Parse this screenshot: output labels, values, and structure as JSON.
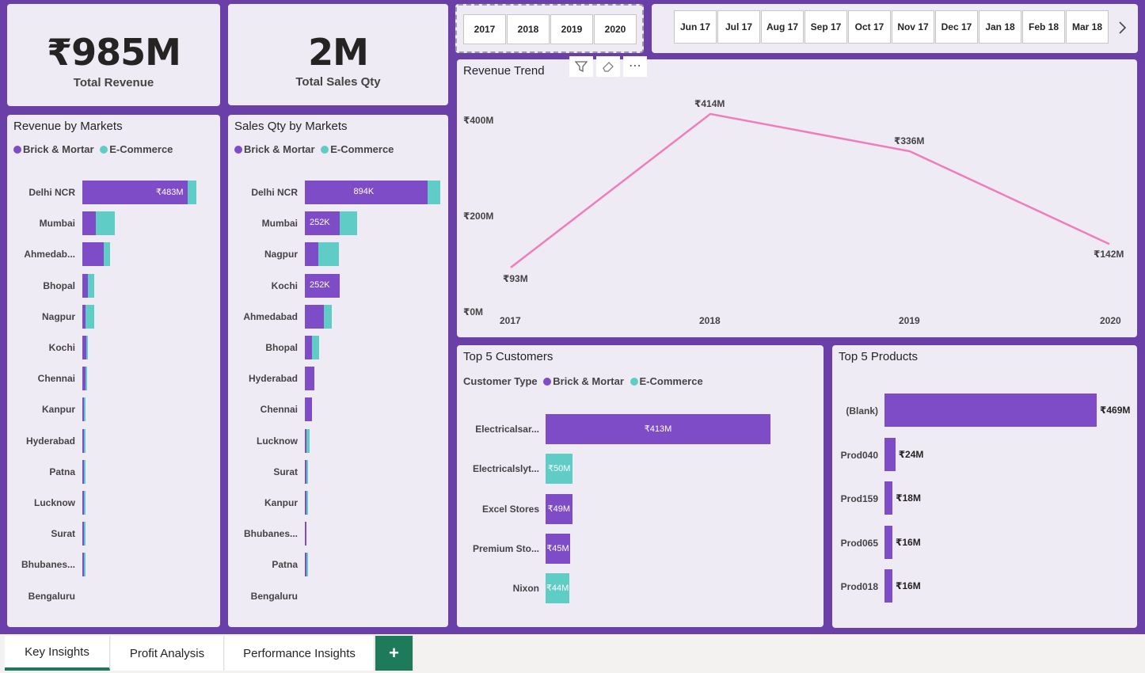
{
  "colors": {
    "brick": "#7e4cc6",
    "ecom": "#5fcdc5",
    "line": "#f07cbc",
    "bg": "#6b3fa8",
    "card": "#efebf5",
    "tab_active": "#1d7a5a"
  },
  "kpis": [
    {
      "value": "₹985M",
      "label": "Total Revenue"
    },
    {
      "value": "2M",
      "label": "Total Sales Qty"
    }
  ],
  "year_slicer": [
    "2017",
    "2018",
    "2019",
    "2020"
  ],
  "month_slicer": [
    "Jun 17",
    "Jul 17",
    "Aug 17",
    "Sep 17",
    "Oct 17",
    "Nov 17",
    "Dec 17",
    "Jan 18",
    "Feb 18",
    "Mar 18"
  ],
  "visual_header_icons": [
    "filter-icon",
    "eraser-icon",
    "more-options-icon"
  ],
  "legend": {
    "brick": "Brick & Mortar",
    "ecom": "E-Commerce",
    "customer_type": "Customer Type"
  },
  "revenue_by_markets": {
    "title": "Revenue by Markets",
    "chart_data": {
      "type": "bar",
      "categories": [
        "Delhi NCR",
        "Mumbai",
        "Ahmedab...",
        "Bhopal",
        "Nagpur",
        "Kochi",
        "Chennai",
        "Kanpur",
        "Hyderabad",
        "Patna",
        "Lucknow",
        "Surat",
        "Bhubanes...",
        "Bengaluru"
      ],
      "series": [
        {
          "name": "Brick & Mortar",
          "values": [
            483,
            62,
            96,
            26,
            16,
            18,
            16,
            6,
            6,
            1,
            1,
            1,
            1,
            0
          ]
        },
        {
          "name": "E-Commerce",
          "values": [
            38,
            86,
            31,
            29,
            40,
            1,
            1,
            6,
            1,
            4,
            2,
            2,
            1,
            0
          ]
        }
      ],
      "data_labels": [
        "₹483M",
        "",
        "",
        "",
        "",
        "",
        "",
        "",
        "",
        "",
        "",
        "",
        "",
        ""
      ],
      "xmax": 521
    }
  },
  "sales_qty_by_markets": {
    "title": "Sales Qty by Markets",
    "chart_data": {
      "type": "bar",
      "categories": [
        "Delhi NCR",
        "Mumbai",
        "Nagpur",
        "Kochi",
        "Ahmedabad",
        "Bhopal",
        "Hyderabad",
        "Chennai",
        "Lucknow",
        "Surat",
        "Kanpur",
        "Bhubanes...",
        "Patna",
        "Bengaluru"
      ],
      "series": [
        {
          "name": "Brick & Mortar",
          "values": [
            894,
            252,
            100,
            252,
            140,
            50,
            70,
            50,
            10,
            5,
            10,
            10,
            5,
            0
          ]
        },
        {
          "name": "E-Commerce",
          "values": [
            94,
            132,
            150,
            0,
            55,
            55,
            0,
            0,
            25,
            10,
            5,
            0,
            5,
            0
          ]
        }
      ],
      "data_labels": [
        "894K",
        "252K",
        "",
        "252K",
        "",
        "",
        "",
        "",
        "",
        "",
        "",
        "",
        "",
        ""
      ],
      "xmax": 988
    }
  },
  "revenue_trend": {
    "title": "Revenue Trend",
    "chart_data": {
      "type": "line",
      "x": [
        "2017",
        "2018",
        "2019",
        "2020"
      ],
      "values": [
        93,
        414,
        336,
        142
      ],
      "data_labels": [
        "₹93M",
        "₹414M",
        "₹336M",
        "₹142M"
      ],
      "yticks": [
        "₹0M",
        "₹200M",
        "₹400M"
      ],
      "ytick_values": [
        0,
        200,
        400
      ],
      "ylim": [
        0,
        500
      ]
    }
  },
  "top_customers": {
    "title": "Top 5 Customers",
    "chart_data": {
      "type": "bar",
      "categories": [
        "Electricalsar...",
        "Electricalslyt...",
        "Excel Stores",
        "Premium Sto...",
        "Nixon"
      ],
      "values": [
        413,
        50,
        49,
        45,
        44
      ],
      "series_type": [
        "brick",
        "ecom",
        "brick",
        "brick",
        "ecom"
      ],
      "data_labels": [
        "₹413M",
        "₹50M",
        "₹49M",
        "₹45M",
        "₹44M"
      ],
      "xmax": 413
    }
  },
  "top_products": {
    "title": "Top 5 Products",
    "chart_data": {
      "type": "bar",
      "categories": [
        "(Blank)",
        "Prod040",
        "Prod159",
        "Prod065",
        "Prod018"
      ],
      "values": [
        469,
        24,
        18,
        16,
        16
      ],
      "data_labels": [
        "₹469M",
        "₹24M",
        "₹18M",
        "₹16M",
        "₹16M"
      ],
      "xmax": 469
    }
  },
  "tabs": [
    "Key Insights",
    "Profit Analysis",
    "Performance Insights"
  ],
  "add_tab": "+"
}
